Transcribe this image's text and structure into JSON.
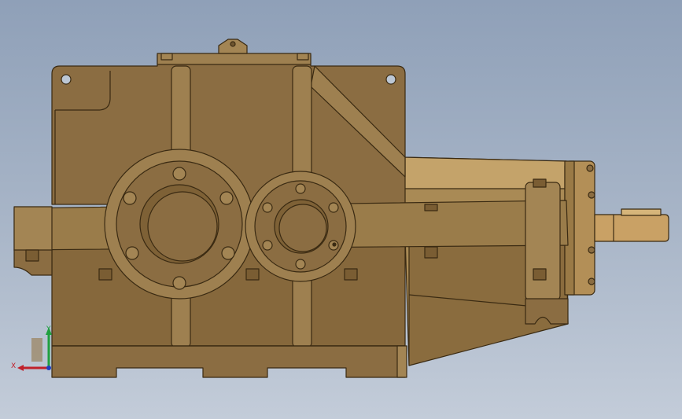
{
  "viewport": {
    "model": "gearbox-assembly",
    "view": "front",
    "colors": {
      "body": "#8b6d42",
      "body_light": "#a38554",
      "body_dark": "#6e5530",
      "edge": "#3a2a12",
      "shaft": "#c9a165",
      "housing_side": "#b8955a",
      "background_top": "#8fa0b8",
      "background_bottom": "#c3ccd9"
    }
  },
  "triad": {
    "x_label": "X",
    "y_label": "Y",
    "x_color": "#c0202a",
    "y_color": "#20a040",
    "z_color": "#2040c0"
  }
}
